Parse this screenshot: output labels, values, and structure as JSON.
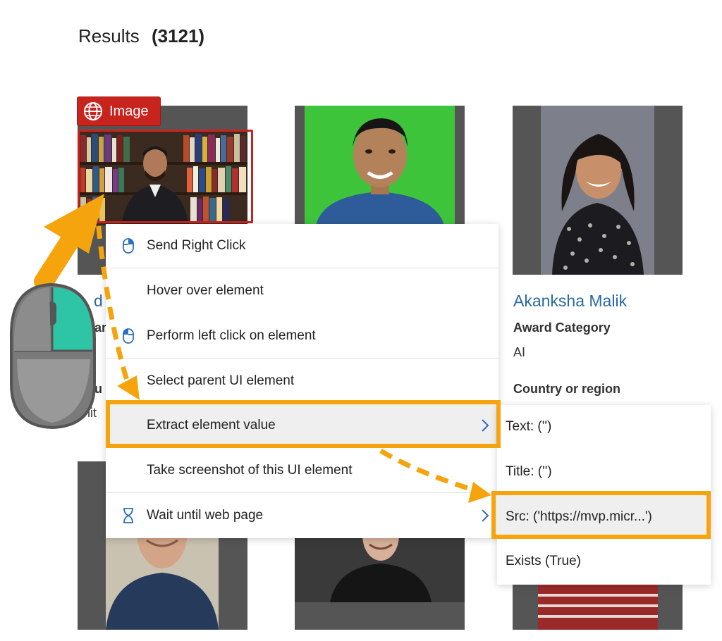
{
  "results": {
    "label": "Results",
    "count": "(3121)"
  },
  "image_tag": {
    "label": "Image",
    "icon": "globe-icon",
    "color": "#c9231d"
  },
  "profile": {
    "name": "Akanksha Malik",
    "award_label": "Award Category",
    "award_value": "AI",
    "country_label": "Country or region"
  },
  "partial_left": {
    "name_fragment": "d",
    "award_fragment": "ar",
    "country_fragment": "u",
    "value_fragment": "hit"
  },
  "menu": {
    "items": [
      {
        "label": "Send Right Click",
        "icon": "mouse-right-click-icon"
      },
      {
        "label": "Hover over element",
        "icon": ""
      },
      {
        "label": "Perform left click on element",
        "icon": "mouse-left-click-icon"
      },
      {
        "label": "Select parent UI element",
        "icon": ""
      },
      {
        "label": "Extract element value",
        "icon": "",
        "submenu": true
      },
      {
        "label": "Take screenshot of this UI element",
        "icon": ""
      },
      {
        "label": "Wait until web page",
        "icon": "hourglass-icon",
        "submenu": true
      }
    ]
  },
  "submenu": {
    "items": [
      {
        "label": "Text:  ('')"
      },
      {
        "label": "Title:  ('')"
      },
      {
        "label": "Src:  ('https://mvp.micr...')"
      },
      {
        "label": "Exists (True)"
      }
    ]
  },
  "colors": {
    "accent_orange": "#f5a40e",
    "link_blue": "#2a6aa0",
    "tag_red": "#c9231d",
    "mouse_teal": "#2ec4a6"
  }
}
